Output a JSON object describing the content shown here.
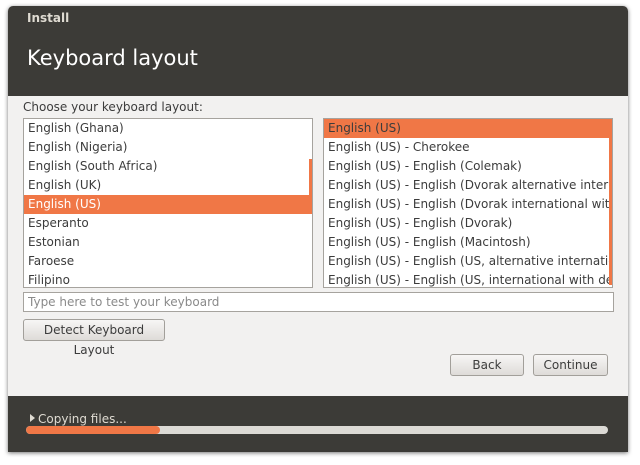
{
  "window": {
    "title": "Install",
    "heading": "Keyboard layout"
  },
  "prompt": "Choose your keyboard layout:",
  "layouts": {
    "items": [
      "English (Ghana)",
      "English (Nigeria)",
      "English (South Africa)",
      "English (UK)",
      "English (US)",
      "Esperanto",
      "Estonian",
      "Faroese",
      "Filipino"
    ],
    "selected": "English (US)"
  },
  "variants": {
    "items": [
      "English (US)",
      "English (US) - Cherokee",
      "English (US) - English (Colemak)",
      "English (US) - English (Dvorak alternative international no dead keys)",
      "English (US) - English (Dvorak international with dead keys)",
      "English (US) - English (Dvorak)",
      "English (US) - English (Macintosh)",
      "English (US) - English (US, alternative international)",
      "English (US) - English (US, international with dead keys)"
    ],
    "selected": "English (US)"
  },
  "test_field": {
    "value": "",
    "placeholder": "Type here to test your keyboard"
  },
  "buttons": {
    "detect": "Detect Keyboard Layout",
    "back": "Back",
    "continue": "Continue"
  },
  "footer": {
    "status": "Copying files...",
    "progress": 0.23
  },
  "colors": {
    "accent": "#f07746",
    "chrome": "#3c3b37",
    "background": "#f2f1f0"
  }
}
